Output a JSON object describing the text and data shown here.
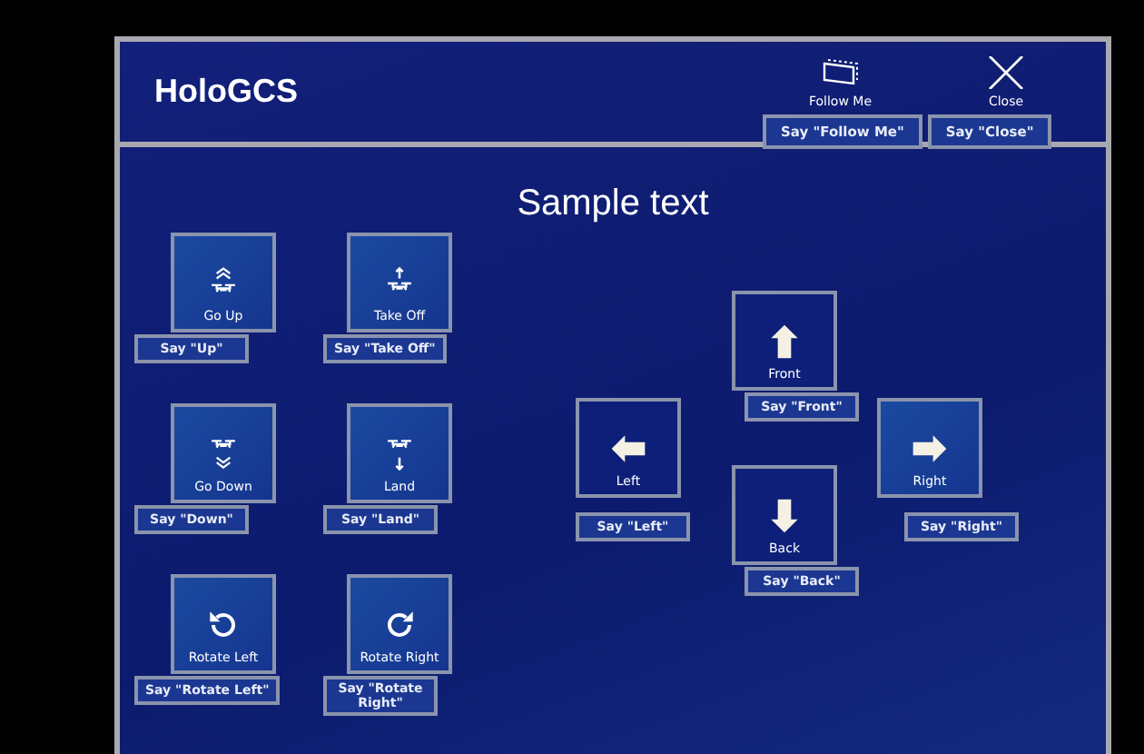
{
  "window": {
    "title": "HoloGCS"
  },
  "header_buttons": [
    {
      "kind": "follow",
      "label": "Follow Me",
      "voice": "Say \"Follow Me\""
    },
    {
      "kind": "close",
      "label": "Close",
      "voice": "Say \"Close\""
    }
  ],
  "heading": "Sample text",
  "altitude_controls": [
    {
      "kind": "up",
      "label": "Go Up",
      "voice": "Say \"Up\"",
      "highlighted": true
    },
    {
      "kind": "takeoff",
      "label": "Take Off",
      "voice": "Say \"Take Off\"",
      "highlighted": true
    },
    {
      "kind": "down",
      "label": "Go Down",
      "voice": "Say \"Down\"",
      "highlighted": true
    },
    {
      "kind": "land",
      "label": "Land",
      "voice": "Say \"Land\"",
      "highlighted": true
    },
    {
      "kind": "rotate-left",
      "label": "Rotate Left",
      "voice": "Say \"Rotate Left\"",
      "highlighted": true
    },
    {
      "kind": "rotate-right",
      "label": "Rotate Right",
      "voice": "Say \"Rotate Right\"",
      "highlighted": true
    }
  ],
  "direction_controls": [
    {
      "kind": "front",
      "label": "Front",
      "voice": "Say \"Front\"",
      "highlighted": false
    },
    {
      "kind": "left",
      "label": "Left",
      "voice": "Say \"Left\"",
      "highlighted": false
    },
    {
      "kind": "right",
      "label": "Right",
      "voice": "Say \"Right\"",
      "highlighted": true
    },
    {
      "kind": "back",
      "label": "Back",
      "voice": "Say \"Back\"",
      "highlighted": false
    }
  ]
}
